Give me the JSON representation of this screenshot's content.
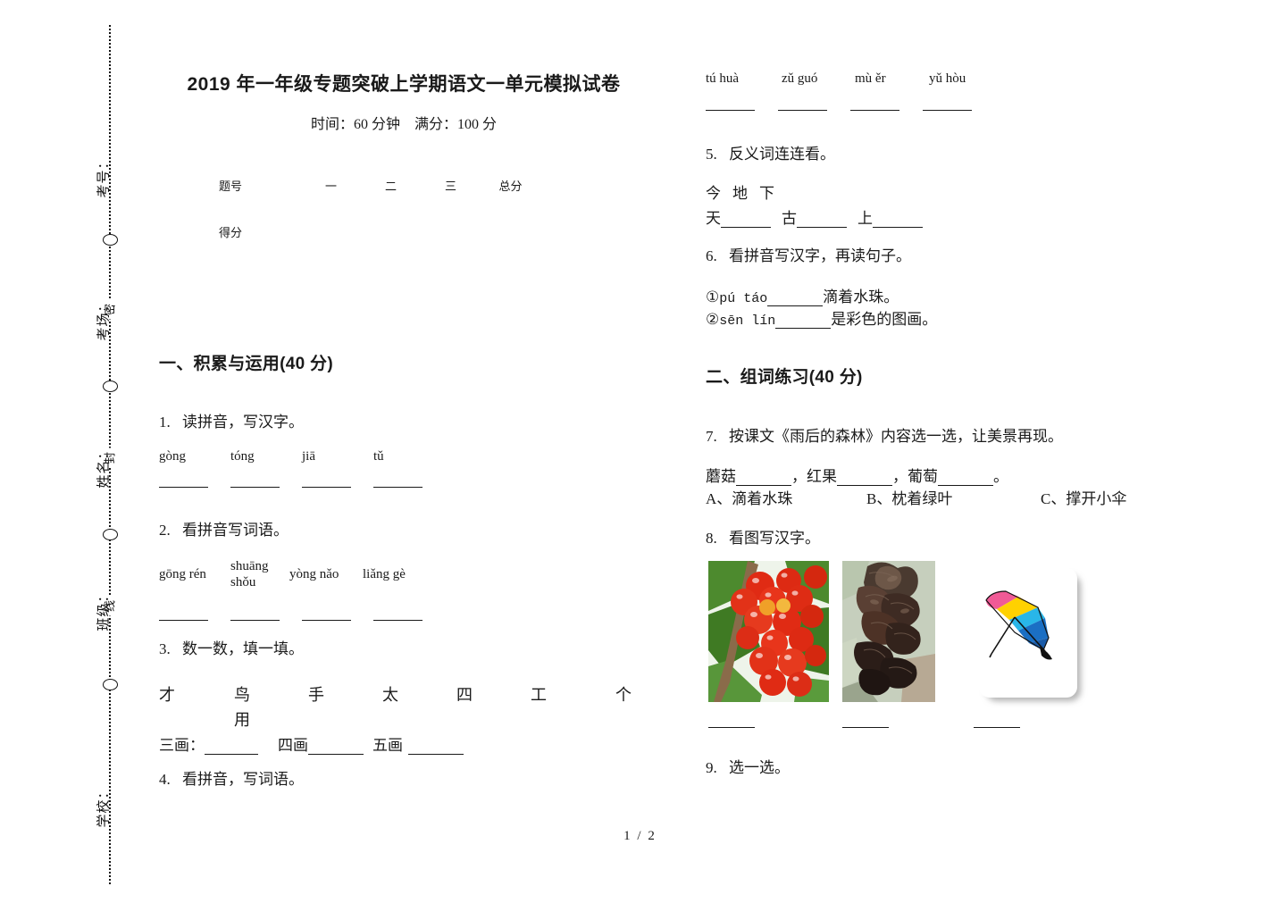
{
  "document": {
    "title": "2019 年一年级专题突破上学期语文一单元模拟试卷",
    "subtitle": "时间：60 分钟　满分：100 分",
    "footer": "1 / 2"
  },
  "seal_margin": {
    "labels": [
      {
        "text": "考号："
      },
      {
        "text": "考场："
      },
      {
        "text": "姓名："
      },
      {
        "text": "班级："
      },
      {
        "text": "学校："
      }
    ],
    "line_chars": [
      {
        "text": "密"
      },
      {
        "text": "封"
      },
      {
        "text": "线"
      }
    ]
  },
  "score_table": {
    "header": [
      "题号",
      "一",
      "二",
      "三",
      "总分"
    ],
    "row_label": "得分",
    "row_values": [
      "",
      "",
      "",
      ""
    ]
  },
  "sections": [
    {
      "id": "sec1",
      "heading": "一、积累与运用(40 分)"
    },
    {
      "id": "sec2",
      "heading": "二、组词练习(40 分)"
    }
  ],
  "questions": {
    "q1": {
      "num": "1.",
      "prompt": "读拼音，写汉字。",
      "pinyin": [
        "gòng",
        "tóng",
        "jiā",
        "tǔ"
      ]
    },
    "q2": {
      "num": "2.",
      "prompt": "看拼音写词语。",
      "pinyin": [
        "gōng rén",
        "shuāng shǒu",
        "yòng nǎo",
        "liǎng gè"
      ],
      "pinyin_stacked": {
        "line1": "shuāng",
        "line2": "shǒu"
      }
    },
    "q3": {
      "num": "3.",
      "prompt": "数一数，填一填。",
      "chars_row1": [
        "才",
        "鸟",
        "手",
        "太",
        "四",
        "工",
        "个"
      ],
      "chars_row2": [
        "用"
      ],
      "stroke_labels": [
        "三画：",
        "四画",
        "五画"
      ]
    },
    "q4": {
      "num": "4.",
      "prompt": "看拼音，写词语。",
      "pinyin": [
        "tú huà",
        "zǔ guó",
        "mù ěr",
        "yǔ hòu"
      ]
    },
    "q5": {
      "num": "5.",
      "prompt": "反义词连连看。",
      "top_row": [
        "今",
        "地",
        "下"
      ],
      "bottom_row": [
        "天",
        "古",
        "上"
      ]
    },
    "q6": {
      "num": "6.",
      "prompt": "看拼音写汉字，再读句子。",
      "items": [
        {
          "marker": "①",
          "pinyin": "pú táo",
          "tail": "滴着水珠。"
        },
        {
          "marker": "②",
          "pinyin": "sēn lín",
          "tail": "是彩色的图画。"
        }
      ]
    },
    "q7": {
      "num": "7.",
      "prompt": "按课文《雨后的森林》内容选一选，让美景再现。",
      "fill_words": [
        "蘑菇",
        "红果",
        "葡萄"
      ],
      "fill_punct": [
        "，",
        "，",
        "。"
      ],
      "options": [
        "A、滴着水珠",
        "B、枕着绿叶",
        "C、撑开小伞"
      ]
    },
    "q8": {
      "num": "8.",
      "prompt": "看图写汉字。",
      "images": [
        {
          "name": "red-berries-photo",
          "alt": "红果"
        },
        {
          "name": "black-fungus-photo",
          "alt": "木耳"
        },
        {
          "name": "umbrella-illustration",
          "alt": "小伞"
        }
      ]
    },
    "q9": {
      "num": "9.",
      "prompt": "选一选。"
    }
  },
  "colors": {
    "ink": "#1a1a1a",
    "berry_red": "#e02b14",
    "leaf_green": "#3f7a23",
    "fungus_dark": "#3a2a24",
    "umbrella_pink": "#f05a96",
    "umbrella_yellow": "#ffd100",
    "umbrella_cyan": "#29b6e8",
    "umbrella_blue": "#1b6fc4"
  }
}
